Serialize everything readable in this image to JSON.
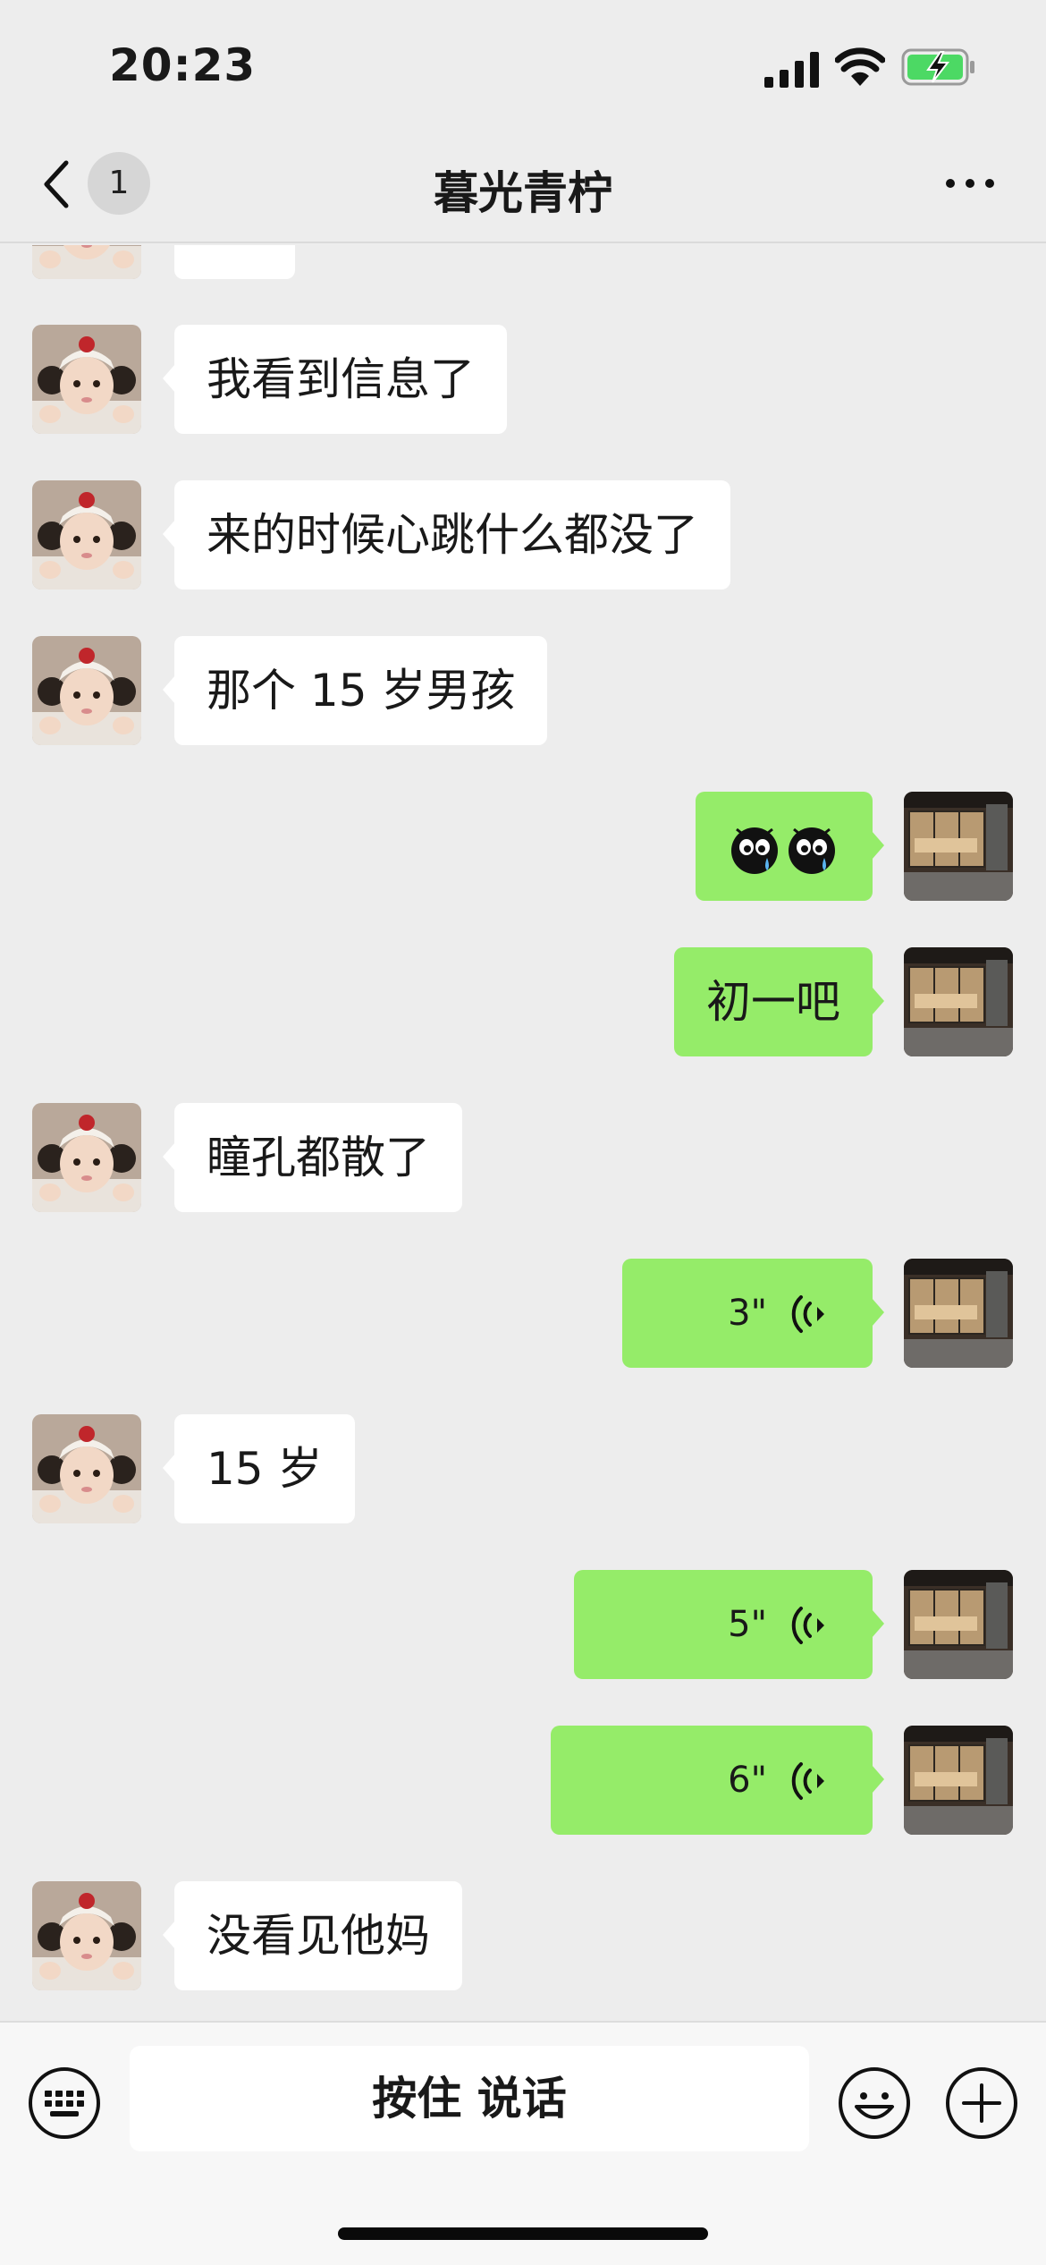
{
  "status_bar": {
    "time": "20:23"
  },
  "nav": {
    "back_badge": "1",
    "title": "暮光青柠"
  },
  "messages": [
    {
      "id": "m0",
      "side": "in",
      "type": "text",
      "text": ""
    },
    {
      "id": "m1",
      "side": "in",
      "type": "text",
      "text": "我看到信息了"
    },
    {
      "id": "m2",
      "side": "in",
      "type": "text",
      "text": "来的时候心跳什么都没了"
    },
    {
      "id": "m3",
      "side": "in",
      "type": "text",
      "text": "那个 15 岁男孩"
    },
    {
      "id": "m4",
      "side": "out",
      "type": "emoji",
      "emoji": "crying-face-icon x2"
    },
    {
      "id": "m5",
      "side": "out",
      "type": "text",
      "text": "初一吧"
    },
    {
      "id": "m6",
      "side": "in",
      "type": "text",
      "text": "瞳孔都散了"
    },
    {
      "id": "m7",
      "side": "out",
      "type": "voice",
      "duration": "3\""
    },
    {
      "id": "m8",
      "side": "in",
      "type": "text",
      "text": "15 岁"
    },
    {
      "id": "m9",
      "side": "out",
      "type": "voice",
      "duration": "5\""
    },
    {
      "id": "m10",
      "side": "out",
      "type": "voice",
      "duration": "6\""
    },
    {
      "id": "m11",
      "side": "in",
      "type": "text",
      "text": "没看见他妈"
    }
  ],
  "input_bar": {
    "hold_to_talk": "按住 说话"
  },
  "colors": {
    "background": "#ededed",
    "out_bubble": "#95ec69",
    "in_bubble": "#ffffff",
    "battery": "#4cd964"
  }
}
